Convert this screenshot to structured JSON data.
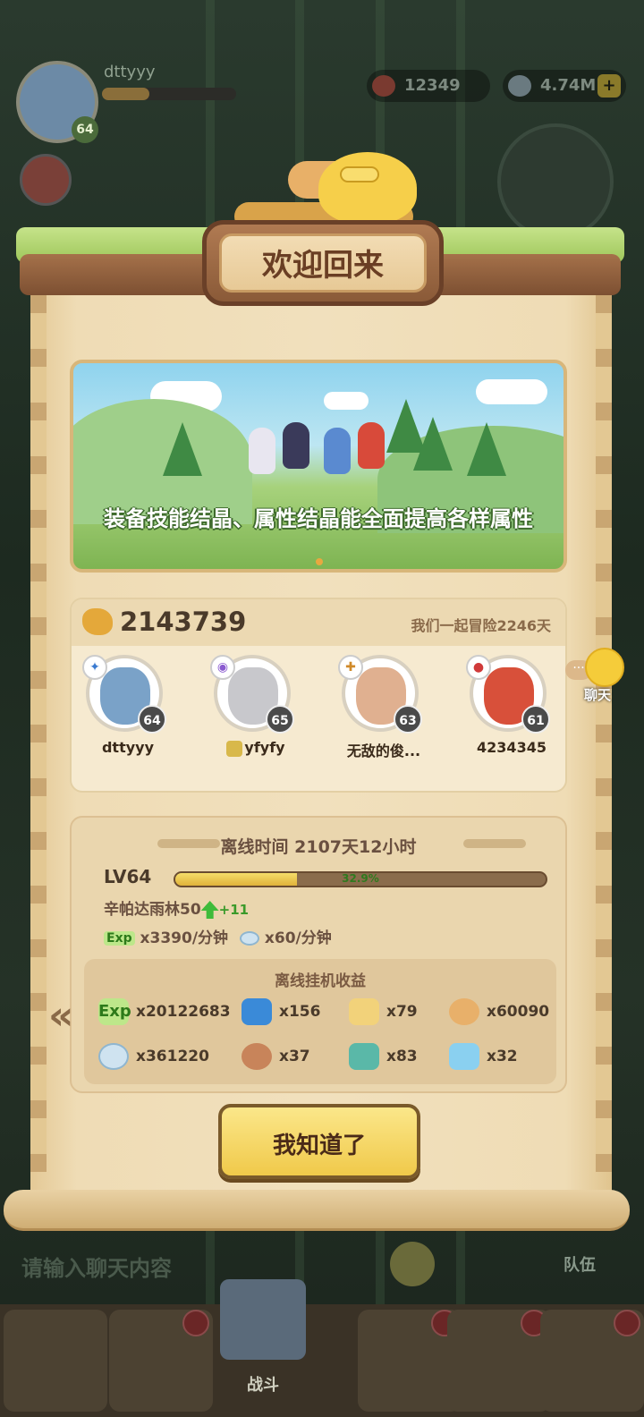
{
  "hud": {
    "player_name": "dttyyy",
    "player_level": "64",
    "currency_1": "12349",
    "currency_2": "4.74M",
    "plus": "+"
  },
  "dialog": {
    "title": "欢迎回来",
    "banner_text": "装备技能结晶、属性结晶能全面提高各样属性",
    "power": "2143739",
    "adventure_days": "我们一起冒险2246天",
    "members": [
      {
        "name": "dttyyy",
        "level": "64"
      },
      {
        "name": "yfyfy",
        "level": "65"
      },
      {
        "name": "无敌的俊...",
        "level": "63"
      },
      {
        "name": "4234345",
        "level": "61"
      }
    ],
    "chat_label": "聊天",
    "offline_time": "离线时间 2107天12小时",
    "lv_label": "LV64",
    "lv_progress_pct": "32.9%",
    "lv_progress": 0.329,
    "stage": "辛帕达雨林50",
    "stage_bonus": "+11",
    "exp_rate": "x3390/分钟",
    "gem_rate": "x60/分钟",
    "exp_tag": "Exp",
    "rewards_title": "离线挂机收益",
    "rewards": [
      {
        "icon": "exp-icon",
        "value": "x20122683"
      },
      {
        "icon": "shirt-icon",
        "value": "x156"
      },
      {
        "icon": "fire-stone-icon",
        "value": "x79"
      },
      {
        "icon": "medal-icon",
        "value": "x60090"
      },
      {
        "icon": "gem-icon",
        "value": "x361220"
      },
      {
        "icon": "meat-icon",
        "value": "x37"
      },
      {
        "icon": "crystal-shard-icon",
        "value": "x83"
      },
      {
        "icon": "ice-crystal-icon",
        "value": "x32"
      }
    ],
    "ok_button": "我知道了"
  },
  "background": {
    "chat_placeholder": "请输入聊天内容",
    "team_label": "队伍",
    "battle_label": "战斗"
  },
  "colors": {
    "title_text": "#6a3e24",
    "button": "#f0c94a",
    "progress": "#e0b23a"
  }
}
